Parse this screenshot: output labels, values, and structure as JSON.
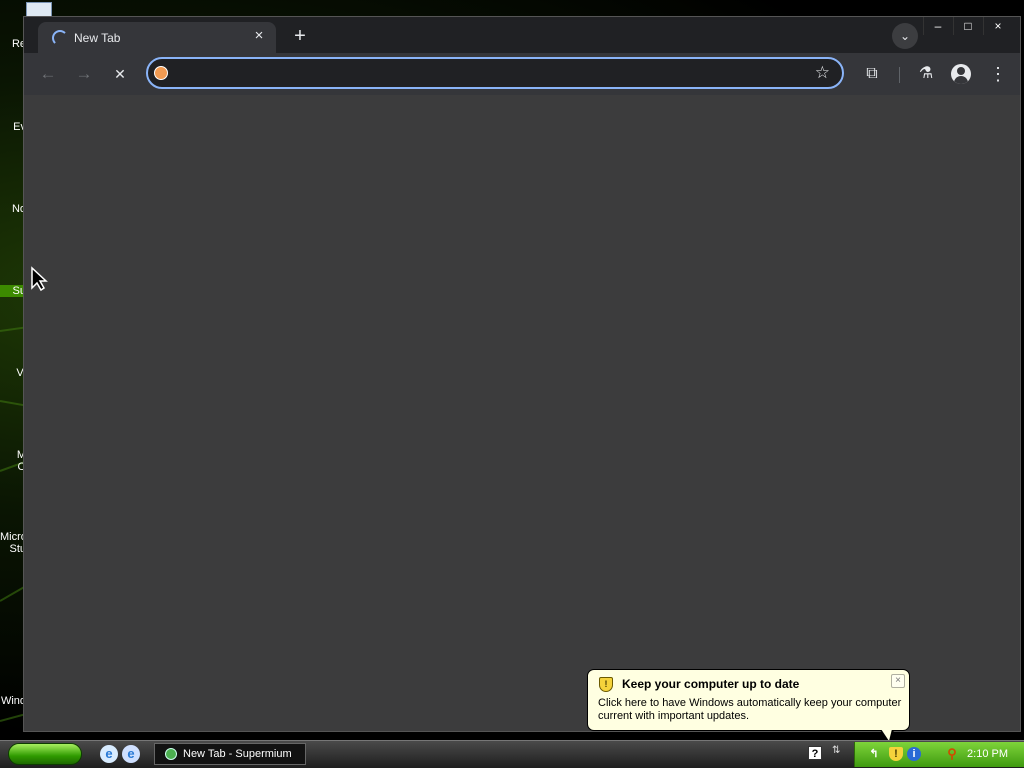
{
  "desktop": {
    "icons": [
      {
        "label": "Re",
        "selected": false
      },
      {
        "label": "Ev",
        "selected": false
      },
      {
        "label": "No",
        "selected": false
      },
      {
        "label": "Su",
        "selected": true
      },
      {
        "label": "Vi",
        "selected": false
      },
      {
        "label": "M\nO",
        "selected": false
      },
      {
        "label": "Micro\nStu",
        "selected": false
      },
      {
        "label": "Wind",
        "selected": false
      }
    ]
  },
  "browser": {
    "tab": {
      "title": "New Tab",
      "close_glyph": "×",
      "loading": true
    },
    "new_tab_glyph": "+",
    "tab_search_glyph": "⌄",
    "window_controls": {
      "minimize": "–",
      "maximize": "□",
      "close": "×"
    },
    "toolbar": {
      "back_glyph": "←",
      "forward_glyph": "→",
      "stop_glyph": "✕",
      "address_value": "",
      "bookmark_glyph": "☆",
      "extensions_glyph": "⧉",
      "labs_glyph": "⚗",
      "menu_glyph": "⋮"
    },
    "colors": {
      "accent": "#8ab4f8",
      "content_bg": "#3c3c3d",
      "toolbar_bg": "#35363a"
    }
  },
  "balloon": {
    "title": "Keep your computer up to date",
    "text": "Click here to have Windows automatically keep your computer current with important updates.",
    "close_glyph": "×",
    "icon": "security-shield-icon"
  },
  "taskbar": {
    "start_label": "",
    "quick_launch": [
      "ie-icon",
      "browser-icon"
    ],
    "task_button_label": "New Tab - Supermium",
    "clock": "2:10 PM",
    "tray_icons": [
      "network-icon",
      "security-shield-icon",
      "info-icon",
      "search-icon"
    ]
  }
}
